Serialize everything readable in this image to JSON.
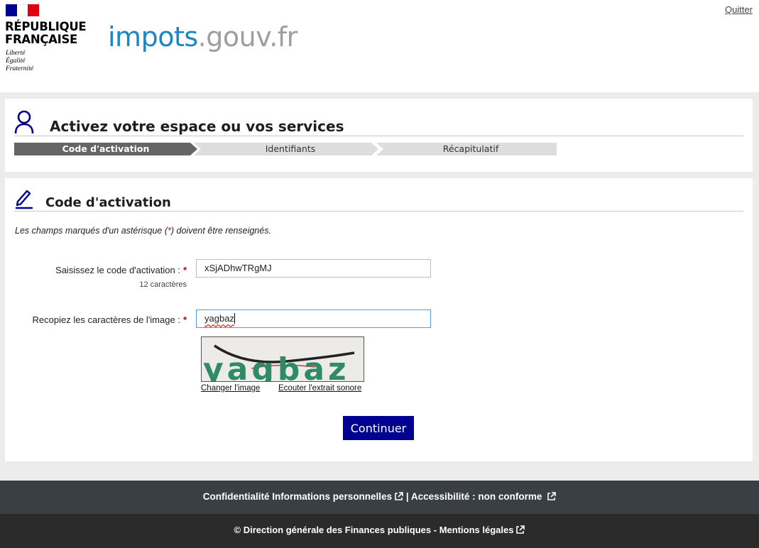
{
  "header": {
    "republic_line1": "RÉPUBLIQUE",
    "republic_line2": "FRANÇAISE",
    "motto": [
      "Liberté",
      "Égalité",
      "Fraternité"
    ],
    "logo_part1": "impots",
    "logo_part2": ".gouv.fr",
    "quit_link": "Quitter"
  },
  "colors": {
    "flag_blue": "#000091",
    "flag_white": "#ffffff",
    "flag_red": "#e1000f",
    "logo_blue": "#1d86c4",
    "button_blue": "#000091",
    "active_step": "#656565",
    "inactive_step": "#dddddd"
  },
  "activation_panel": {
    "title": "Activez votre espace ou vos services",
    "icon": "user-icon",
    "steps": [
      {
        "label": "Code d'activation",
        "active": true
      },
      {
        "label": "Identifiants",
        "active": false
      },
      {
        "label": "Récapitulatif",
        "active": false
      }
    ]
  },
  "form_panel": {
    "title": "Code d'activation",
    "icon": "pencil-icon",
    "required_note_before": "Les champs marqués d'un astérisque (",
    "required_star": "*",
    "required_note_after": ") doivent être renseignés.",
    "activation_code": {
      "label": "Saisissez le code d'activation :",
      "star": "*",
      "hint": "12 caractères",
      "value": "xSjADhwTRgMJ"
    },
    "captcha": {
      "label": "Recopiez les caractères de l'image :",
      "star": "*",
      "value": "yagbaz",
      "image_text": "yagbaz",
      "change_image": "Changer l'image",
      "listen_audio": "Ecouter l'extrait sonore"
    },
    "submit_label": "Continuer"
  },
  "footer": {
    "privacy": "Confidentialité Informations personnelles",
    "separator": "|",
    "accessibility": "Accessibilité : non conforme",
    "copyright": "© Direction générale des Finances publiques - Mentions légales"
  }
}
